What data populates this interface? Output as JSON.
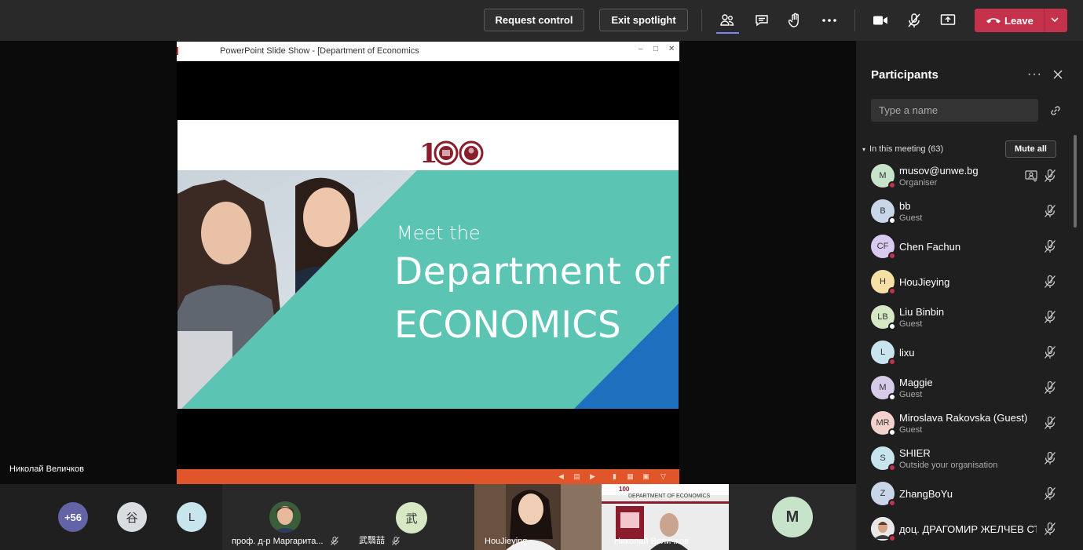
{
  "toolbar": {
    "request_control": "Request control",
    "exit_spotlight": "Exit spotlight",
    "leave": "Leave",
    "icons": [
      "people-icon",
      "chat-icon",
      "raise-hand-icon",
      "more-icon",
      "camera-icon",
      "mic-off-icon",
      "share-screen-icon"
    ],
    "leave_color": "#c4314b"
  },
  "presentation": {
    "window_title": "PowerPoint Slide Show - [Department of Economics",
    "logo_text": "100",
    "line1": "Meet the",
    "line2": "Department of",
    "line3": "ECONOMICS",
    "accent_teal": "#5cc4b2",
    "accent_blue": "#1f6fbf",
    "bar_orange": "#e0562a"
  },
  "presenter_name": "Николай Величков",
  "gallery": {
    "overflow_count": "+56",
    "tiles": [
      {
        "initial": "谷"
      },
      {
        "initial": "L"
      },
      {
        "name": "проф. д-р Маргарита..."
      },
      {
        "initial": "武",
        "name": "武翳喆"
      },
      {
        "name": "HouJieying"
      },
      {
        "name": "Николай Величков",
        "screen_text": "DEPARTMENT OF ECONOMICS"
      },
      {
        "initial": "M"
      }
    ]
  },
  "participants_panel": {
    "title": "Participants",
    "search_placeholder": "Type a name",
    "section_label": "In this meeting (63)",
    "mute_all": "Mute all",
    "participants": [
      {
        "initials": "M",
        "name": "musov@unwe.bg",
        "role": "Organiser",
        "color": "#c7e3c9",
        "status": "#c4314b"
      },
      {
        "initials": "B",
        "name": "bb",
        "role": "Guest",
        "color": "#c9d5e8",
        "status": "#ffffff"
      },
      {
        "initials": "CF",
        "name": "Chen Fachun",
        "role": "",
        "color": "#d9cbf0",
        "status": "#c4314b"
      },
      {
        "initials": "H",
        "name": "HouJieying",
        "role": "",
        "color": "#f7e0a6",
        "status": "#c4314b"
      },
      {
        "initials": "LB",
        "name": "Liu Binbin",
        "role": "Guest",
        "color": "#d6e8c4",
        "status": "#ffffff"
      },
      {
        "initials": "L",
        "name": "lixu",
        "role": "",
        "color": "#c8e4ec",
        "status": "#c4314b"
      },
      {
        "initials": "M",
        "name": "Maggie",
        "role": "Guest",
        "color": "#d6cbe8",
        "status": "#ffffff"
      },
      {
        "initials": "MR",
        "name": "Miroslava Rakovska (Guest)",
        "role": "Guest",
        "color": "#f3d2cd",
        "status": "#ffffff"
      },
      {
        "initials": "S",
        "name": "SHIER",
        "role": "Outside your organisation",
        "color": "#c8e4ec",
        "status": "#c4314b"
      },
      {
        "initials": "Z",
        "name": "ZhangBoYu",
        "role": "",
        "color": "#c9d5e8",
        "status": "#c4314b"
      },
      {
        "initials": "",
        "name": "доц. ДРАГОМИР ЖЕЛЧЕВ СТ...",
        "role": "",
        "color": "#e8d2c0",
        "status": "#c4314b"
      }
    ]
  }
}
